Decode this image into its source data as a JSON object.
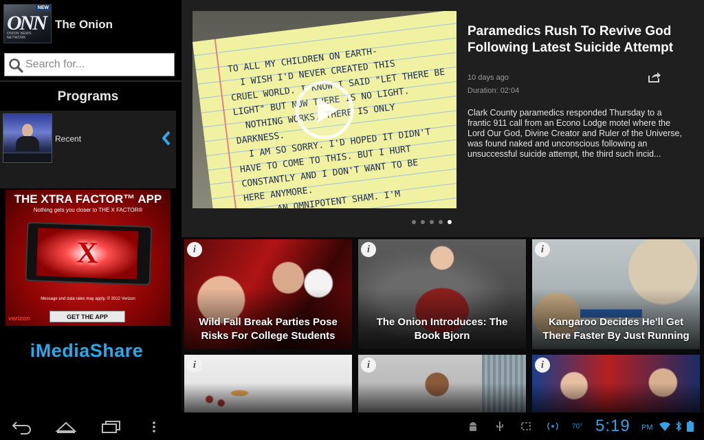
{
  "app": {
    "logo_text": "ONN",
    "logo_subtext": "ONION NEWS NETWORK",
    "logo_badge": "NEW",
    "title": "The Onion"
  },
  "search": {
    "placeholder": "Search for..."
  },
  "programs": {
    "heading": "Programs",
    "items": [
      {
        "label": "Recent"
      }
    ]
  },
  "ad": {
    "title": "THE XTRA FACTOR™ APP",
    "subtitle": "Nothing gets you closer to THE X FACTOR®",
    "disclaimer": "Message and data rates may apply. © 2012 Verizon",
    "cta": "GET THE APP",
    "carrier": "verizon"
  },
  "brand": {
    "name": "iMediaShare"
  },
  "featured": {
    "title": "Paramedics Rush To Revive God Following Latest Suicide Attempt",
    "posted": "10 days ago",
    "duration": "Duration: 02:04",
    "description": "Clark County paramedics responded Thursday to a frantic 911 call from an Econo Lodge motel where the Lord Our God, Divine Creator and Ruler of the Universe, was found naked and unconscious following an unsuccessful suicide attempt, the third such incid...",
    "pager_count": 5,
    "pager_active": 5
  },
  "videos": [
    {
      "title": "Wild Fall Break Parties Pose Risks For College Students"
    },
    {
      "title": "The Onion Introduces: The Book Bjorn"
    },
    {
      "title": "Kangaroo Decides He'll Get There Faster By Just Running"
    },
    {
      "title": ""
    },
    {
      "title": ""
    },
    {
      "title": ""
    }
  ],
  "status_bar": {
    "temperature": "70°",
    "time": "5:19",
    "ampm": "PM"
  },
  "colors": {
    "accent_blue": "#32a3e6",
    "ad_red": "#c70000"
  }
}
